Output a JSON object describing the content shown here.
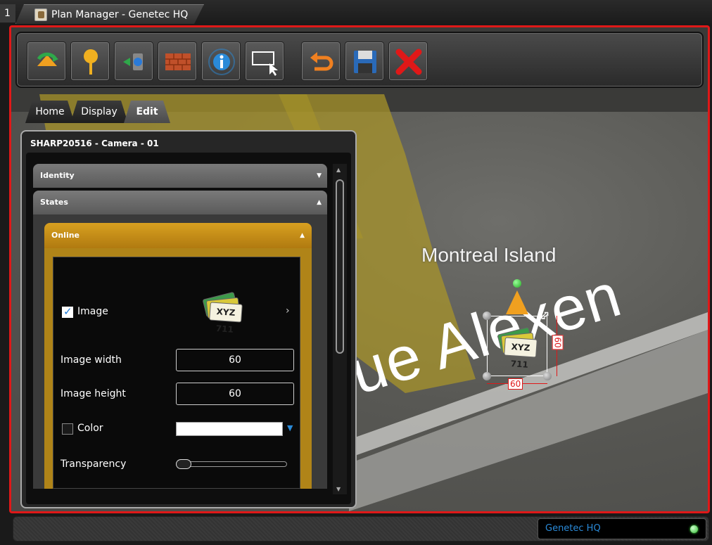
{
  "tabbar": {
    "index": "1",
    "app_title": "Plan Manager - Genetec HQ"
  },
  "toolbar": {
    "tools": [
      {
        "name": "move-tool-icon",
        "color": "#2fa84a"
      },
      {
        "name": "location-pin-icon",
        "color": "#f0b020"
      },
      {
        "name": "door-icon",
        "color": "#2a7ad8"
      },
      {
        "name": "wall-icon",
        "color": "#c0502a"
      },
      {
        "name": "info-icon",
        "color": "#2a8ad8"
      },
      {
        "name": "select-area-icon",
        "color": "#ffffff"
      },
      {
        "name": "undo-icon",
        "color": "#f08020"
      },
      {
        "name": "save-icon",
        "color": "#2a6ab8"
      },
      {
        "name": "close-icon",
        "color": "#e01818"
      }
    ]
  },
  "ribbon": {
    "tabs": [
      "Home",
      "Display",
      "Edit"
    ],
    "active": "Edit"
  },
  "panel": {
    "title": "SHARP20516 - Camera - 01",
    "sections": {
      "identity": "Identity",
      "states": "States",
      "online": "Online"
    },
    "image": {
      "label": "Image",
      "checked": true,
      "plate_text": "XYZ 711"
    },
    "image_width": {
      "label": "Image width",
      "value": "60"
    },
    "image_height": {
      "label": "Image height",
      "value": "60"
    },
    "color": {
      "label": "Color",
      "checked": false,
      "swatch": "#ffffff"
    },
    "transparency": {
      "label": "Transparency",
      "value": 0
    }
  },
  "map": {
    "island_label": "Montreal Island",
    "street_label": "ue Alexen",
    "object": {
      "width_label": "60",
      "height_label": "60",
      "plate_text": "XYZ 711"
    }
  },
  "status": {
    "server_name": "Genetec HQ",
    "led_color": "#33bb33"
  }
}
